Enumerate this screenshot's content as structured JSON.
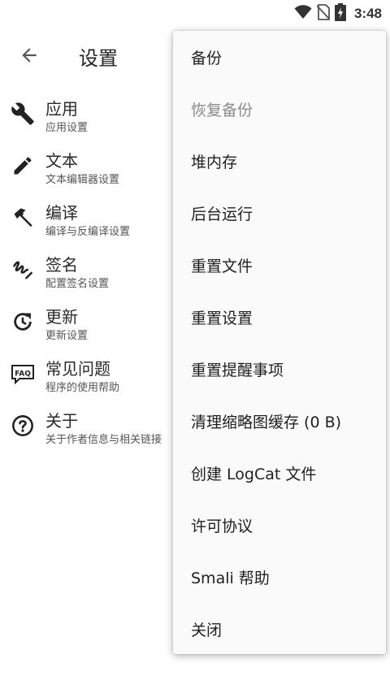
{
  "status_bar": {
    "time": "3:48",
    "icons": [
      "wifi-icon",
      "no-sim-icon",
      "battery-charging-icon"
    ]
  },
  "app_bar": {
    "title": "设置",
    "back_icon": "arrow-back-icon"
  },
  "settings": {
    "items": [
      {
        "icon": "wrench-icon",
        "title": "应用",
        "subtitle": "应用设置"
      },
      {
        "icon": "pencil-icon",
        "title": "文本",
        "subtitle": "文本编辑器设置"
      },
      {
        "icon": "hammer-icon",
        "title": "编译",
        "subtitle": "编译与反编译设置"
      },
      {
        "icon": "signature-icon",
        "title": "签名",
        "subtitle": "配置签名设置"
      },
      {
        "icon": "update-icon",
        "title": "更新",
        "subtitle": "更新设置"
      },
      {
        "icon": "faq-icon",
        "title": "常见问题",
        "subtitle": "程序的使用帮助"
      },
      {
        "icon": "help-circle-icon",
        "title": "关于",
        "subtitle": "关于作者信息与相关链接"
      }
    ]
  },
  "menu": {
    "items": [
      {
        "label": "备份",
        "enabled": true
      },
      {
        "label": "恢复备份",
        "enabled": false
      },
      {
        "label": "堆内存",
        "enabled": true
      },
      {
        "label": "后台运行",
        "enabled": true
      },
      {
        "label": "重置文件",
        "enabled": true
      },
      {
        "label": "重置设置",
        "enabled": true
      },
      {
        "label": "重置提醒事项",
        "enabled": true
      },
      {
        "label": "清理缩略图缓存 (0 B)",
        "enabled": true
      },
      {
        "label": "创建 LogCat 文件",
        "enabled": true
      },
      {
        "label": "许可协议",
        "enabled": true
      },
      {
        "label": "Smali 帮助",
        "enabled": true
      },
      {
        "label": "关闭",
        "enabled": true
      }
    ]
  }
}
